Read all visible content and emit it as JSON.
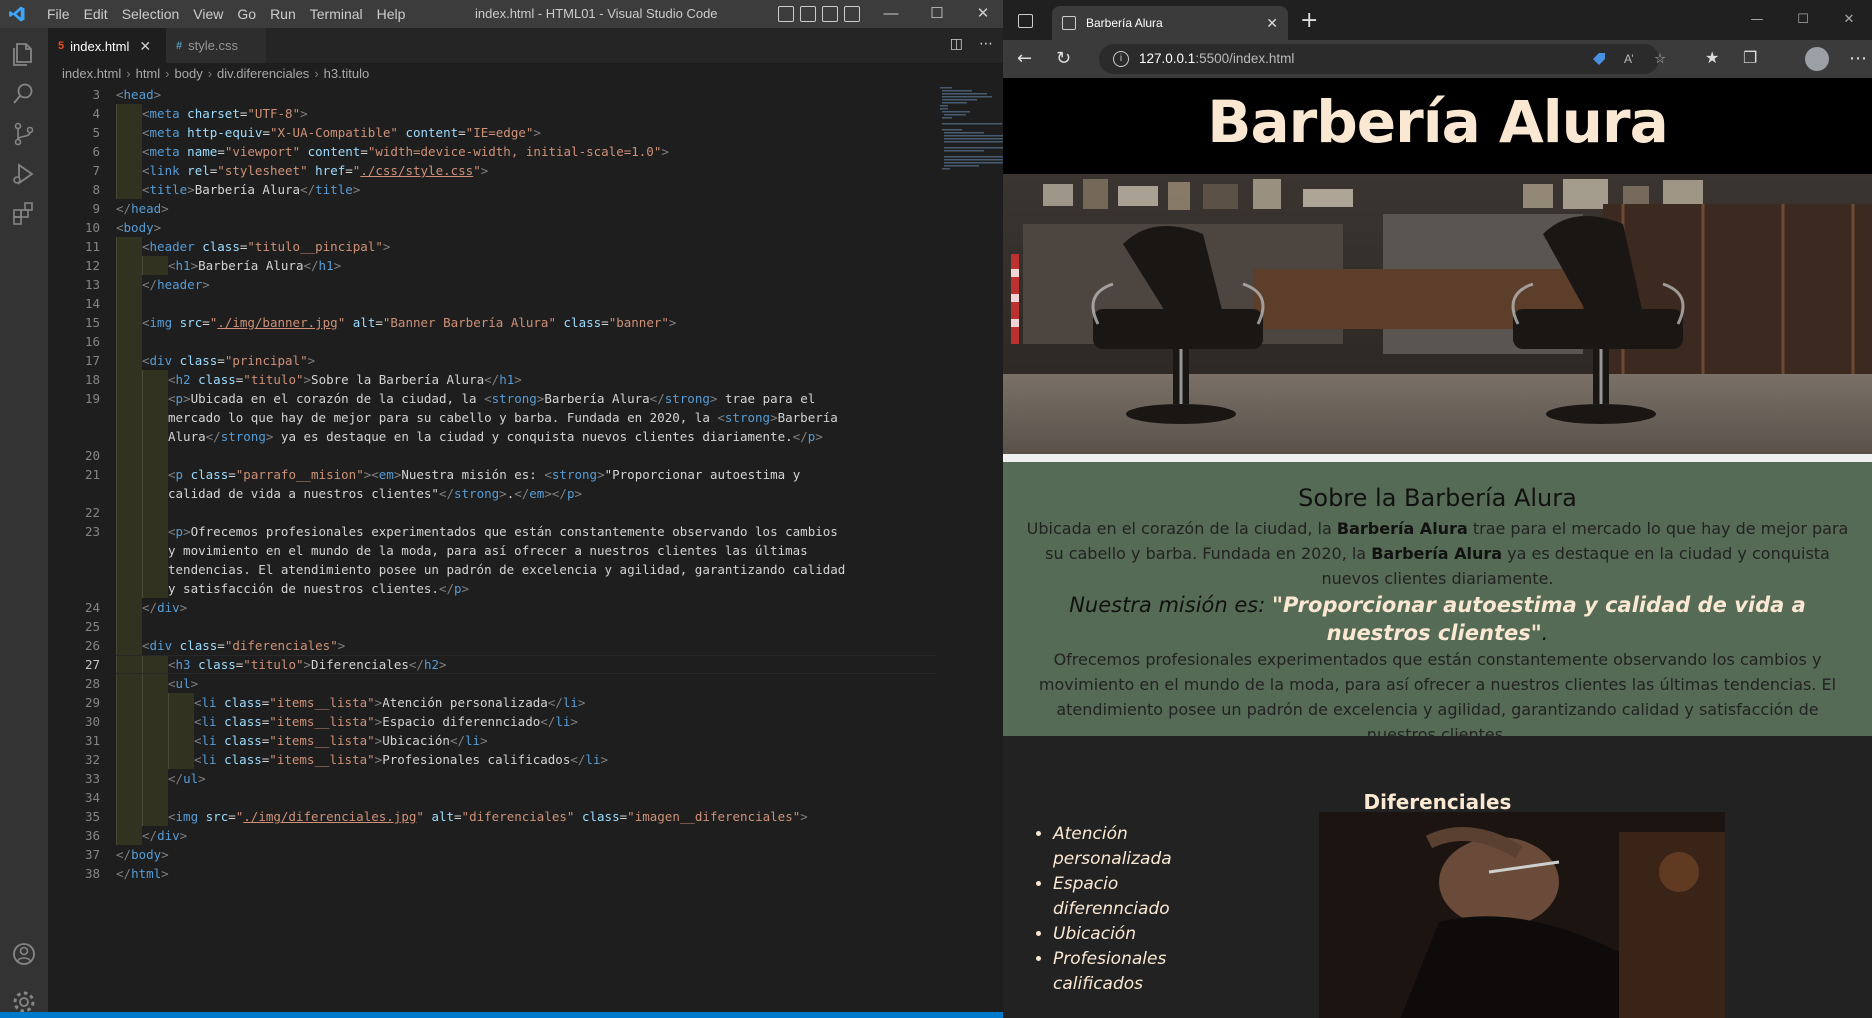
{
  "vscode": {
    "menu": [
      "File",
      "Edit",
      "Selection",
      "View",
      "Go",
      "Run",
      "Terminal",
      "Help"
    ],
    "window_title": "index.html - HTML01 - Visual Studio Code",
    "tabs": [
      {
        "label": "index.html",
        "icon": "html-file-icon",
        "active": true
      },
      {
        "label": "style.css",
        "icon": "css-file-icon",
        "active": false
      }
    ],
    "breadcrumb": [
      "index.html",
      "html",
      "body",
      "div.diferenciales",
      "h3.titulo"
    ],
    "current_line": 27,
    "lines": [
      {
        "n": 3,
        "indent": 0,
        "html": "<head>"
      },
      {
        "n": 4,
        "indent": 1,
        "html": "<meta charset=\"UTF-8\">"
      },
      {
        "n": 5,
        "indent": 1,
        "html": "<meta http-equiv=\"X-UA-Compatible\" content=\"IE=edge\">"
      },
      {
        "n": 6,
        "indent": 1,
        "html": "<meta name=\"viewport\" content=\"width=device-width, initial-scale=1.0\">"
      },
      {
        "n": 7,
        "indent": 1,
        "html": "<link rel=\"stylesheet\" href=\"./css/style.css\">"
      },
      {
        "n": 8,
        "indent": 1,
        "html": "<title>Barbería Alura</title>"
      },
      {
        "n": 9,
        "indent": 0,
        "html": "</head>"
      },
      {
        "n": 10,
        "indent": 0,
        "html": "<body>"
      },
      {
        "n": 11,
        "indent": 1,
        "html": "<header class=\"titulo__pincipal\">"
      },
      {
        "n": 12,
        "indent": 2,
        "html": "<h1>Barbería Alura</h1>"
      },
      {
        "n": 13,
        "indent": 1,
        "html": "</header>"
      },
      {
        "n": 14,
        "indent": 1,
        "html": ""
      },
      {
        "n": 15,
        "indent": 1,
        "html": "<img src=\"./img/banner.jpg\" alt=\"Banner Barbería Alura\" class=\"banner\">"
      },
      {
        "n": 16,
        "indent": 1,
        "html": ""
      },
      {
        "n": 17,
        "indent": 1,
        "html": "<div class=\"principal\">"
      },
      {
        "n": 18,
        "indent": 2,
        "html": "<h2 class=\"titulo\">Sobre la Barbería Alura</h1>"
      },
      {
        "n": 19,
        "indent": 2,
        "html": "<p>Ubicada en el corazón de la ciudad, la <strong>Barbería Alura</strong> trae para el"
      },
      {
        "n": "",
        "indent": 2,
        "html": "mercado lo que hay de mejor para su cabello y barba. Fundada en 2020, la <strong>Barbería"
      },
      {
        "n": "",
        "indent": 2,
        "html": "Alura</strong> ya es destaque en la ciudad y conquista nuevos clientes diariamente.</p>"
      },
      {
        "n": 20,
        "indent": 2,
        "html": ""
      },
      {
        "n": 21,
        "indent": 2,
        "html": "<p class=\"parrafo__mision\"><em>Nuestra misión es: <strong>\"Proporcionar autoestima y"
      },
      {
        "n": "",
        "indent": 2,
        "html": "calidad de vida a nuestros clientes\"</strong>.</em></p>"
      },
      {
        "n": 22,
        "indent": 2,
        "html": ""
      },
      {
        "n": 23,
        "indent": 2,
        "html": "<p>Ofrecemos profesionales experimentados que están constantemente observando los cambios"
      },
      {
        "n": "",
        "indent": 2,
        "html": "y movimiento en el mundo de la moda, para así ofrecer a nuestros clientes las últimas"
      },
      {
        "n": "",
        "indent": 2,
        "html": "tendencias. El atendimiento posee un padrón de excelencia y agilidad, garantizando calidad"
      },
      {
        "n": "",
        "indent": 2,
        "html": "y satisfacción de nuestros clientes.</p>"
      },
      {
        "n": 24,
        "indent": 1,
        "html": "</div>"
      },
      {
        "n": 25,
        "indent": 1,
        "html": ""
      },
      {
        "n": 26,
        "indent": 1,
        "html": "<div class=\"diferenciales\">"
      },
      {
        "n": 27,
        "indent": 2,
        "html": "<h3 class=\"titulo\">Diferenciales</h2>"
      },
      {
        "n": 28,
        "indent": 2,
        "html": "<ul>"
      },
      {
        "n": 29,
        "indent": 3,
        "html": "<li class=\"items__lista\">Atención personalizada</li>"
      },
      {
        "n": 30,
        "indent": 3,
        "html": "<li class=\"items__lista\">Espacio diferennciado</li>"
      },
      {
        "n": 31,
        "indent": 3,
        "html": "<li class=\"items__lista\">Ubicación</li>"
      },
      {
        "n": 32,
        "indent": 3,
        "html": "<li class=\"items__lista\">Profesionales calificados</li>"
      },
      {
        "n": 33,
        "indent": 2,
        "html": "</ul>"
      },
      {
        "n": 34,
        "indent": 2,
        "html": ""
      },
      {
        "n": 35,
        "indent": 2,
        "html": "<img src=\"./img/diferenciales.jpg\" alt=\"diferenciales\" class=\"imagen__diferenciales\">"
      },
      {
        "n": 36,
        "indent": 1,
        "html": "</div>"
      },
      {
        "n": 37,
        "indent": 0,
        "html": "</body>"
      },
      {
        "n": 38,
        "indent": 0,
        "html": "</html>"
      }
    ]
  },
  "browser": {
    "tab_title": "Barbería Alura",
    "url_host": "127.0.0.1",
    "url_rest": ":5500/index.html"
  },
  "site": {
    "title": "Barbería Alura",
    "about_title": "Sobre la Barbería Alura",
    "p1_a": "Ubicada en el corazón de la ciudad, la ",
    "p1_strong1": "Barbería Alura",
    "p1_b": " trae para el mercado lo que hay de mejor para su cabello y barba. Fundada en 2020, la ",
    "p1_strong2": "Barbería Alura",
    "p1_c": " ya es destaque en la ciudad y conquista nuevos clientes diariamente.",
    "mision_prefix": "Nuestra misión es: ",
    "mision_strong": "\"Proporcionar autoestima y calidad de vida a nuestros clientes\"",
    "mision_suffix": ".",
    "p3": "Ofrecemos profesionales experimentados que están constantemente observando los cambios y movimiento en el mundo de la moda, para así ofrecer a nuestros clientes las últimas tendencias. El atendimiento posee un padrón de excelencia y agilidad, garantizando calidad y satisfacción de nuestros clientes.",
    "diferenciales_title": "Diferenciales",
    "diferenciales": [
      "Atención personalizada",
      "Espacio diferennciado",
      "Ubicación",
      "Profesionales calificados"
    ]
  },
  "colors": {
    "accent": "#007acc",
    "site_header_text": "#fbe8d3",
    "principal_bg": "#566b55"
  }
}
